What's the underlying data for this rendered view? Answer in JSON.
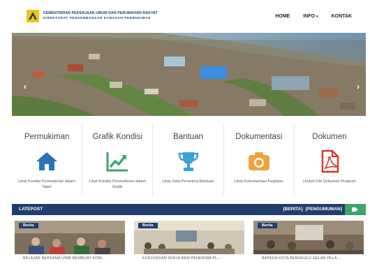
{
  "header": {
    "brand_line1": "KEMENTERIAN PEKERJAAN UMUM DAN PERUMAHAN RAKYAT",
    "brand_line2": "DIREKTORAT PENGEMBANGAN KAWASAN PERMUKIMAN",
    "nav": [
      {
        "label": "HOME"
      },
      {
        "label": "INFO"
      },
      {
        "label": "KONTAK"
      }
    ]
  },
  "hero": {
    "prev_arrow": "‹",
    "next_arrow": "›"
  },
  "features": [
    {
      "title": "Permukiman",
      "desc": "Lihat Kondisi Permukiman dalam Tabel",
      "icon": "home-icon",
      "color": "#2a73b8"
    },
    {
      "title": "Grafik Kondisi",
      "desc": "Lihat Kondisi Permukiman dalam Grafik",
      "icon": "chart-trend-icon",
      "color": "#3fa46a"
    },
    {
      "title": "Bantuan",
      "desc": "Lihat Data Penerima Bantuan",
      "icon": "trophy-icon",
      "color": "#3b9fd8"
    },
    {
      "title": "Dokumentasi",
      "desc": "Lihat Dokumentasi Kegiatan",
      "icon": "camera-icon",
      "color": "#f0a23a"
    },
    {
      "title": "Dokumen",
      "desc": "Unduh File Dokumen Program",
      "icon": "pdf-file-icon",
      "color": "#d9342b"
    }
  ],
  "latest": {
    "label": "LATEPOST",
    "link_berita": "[BERITA]",
    "link_pengumuman": "[PENGUMUMAN]"
  },
  "news": [
    {
      "badge": "Berita",
      "title": "BELAJAR BERSAMA UNIB MEMBUAT KOM..."
    },
    {
      "badge": "Berita",
      "title": "KUNJUNGAN KERJA BKM PENERIMA PL..."
    },
    {
      "badge": "Berita",
      "title": "BAPEDA KOTA BENGKULU GELAR PELA..."
    }
  ]
}
